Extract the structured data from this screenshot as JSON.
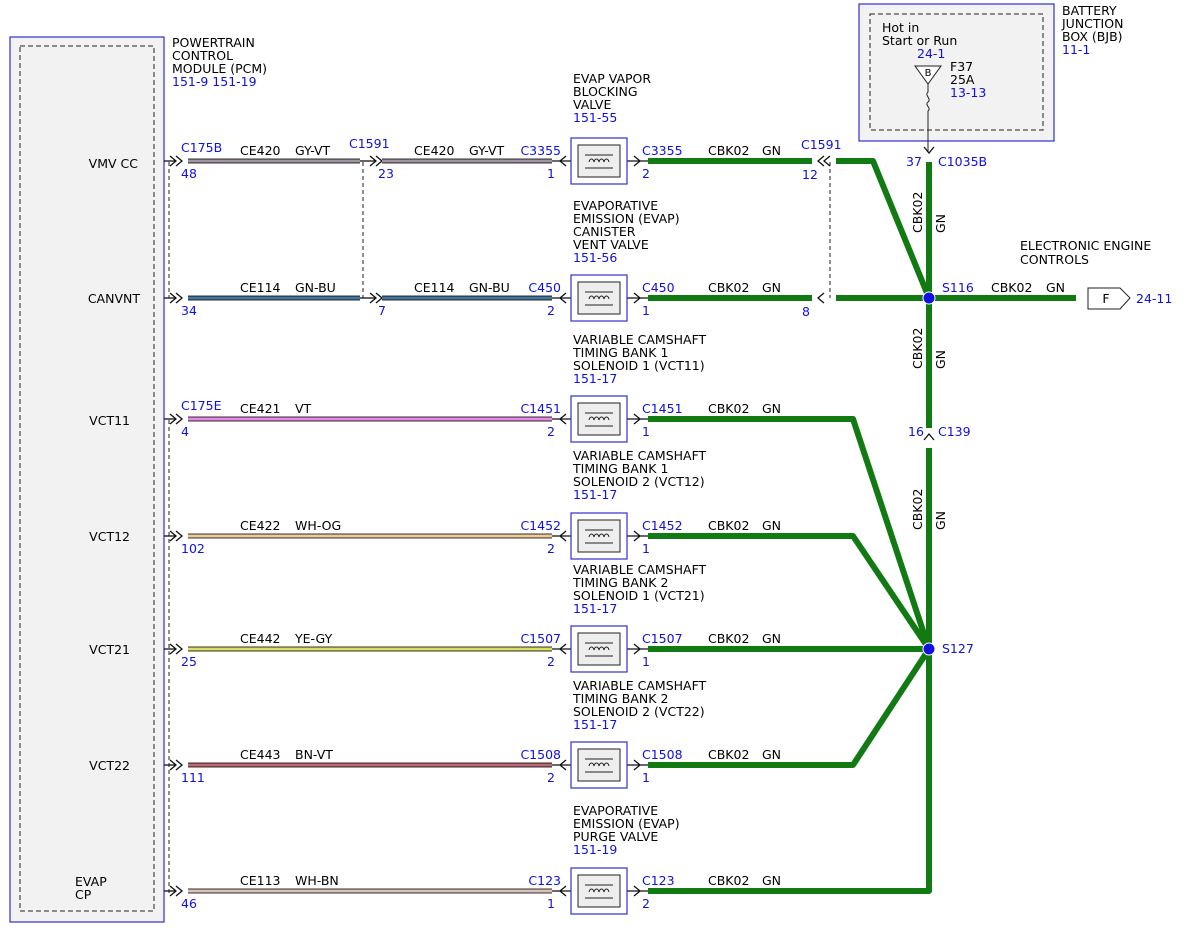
{
  "colors": {
    "gn": "#127a12",
    "gy_vt": "#8f7f8f",
    "gn_bu": "#1e5a8a",
    "vt": "#e470de",
    "wh_og": "#e9c080",
    "ye_gy": "#d6d640",
    "bn_vt": "#b04858",
    "wh_bn": "#d8b4ac",
    "ref_blue": "#1010e0",
    "box_blue": "#3030d0"
  },
  "pcm": {
    "title_lines": [
      "POWERTRAIN",
      "CONTROL",
      "MODULE (PCM)"
    ],
    "refs": "151-9  151-19"
  },
  "pins": {
    "vmv_cc": "VMV CC",
    "canvnt": "CANVNT",
    "vct11": "VCT11",
    "vct12": "VCT12",
    "vct21": "VCT21",
    "vct22": "VCT22",
    "evap_cp_1": "EVAP",
    "evap_cp_2": "CP"
  },
  "bjb": {
    "title_lines": [
      "BATTERY",
      "JUNCTION",
      "BOX (BJB)"
    ],
    "ref": "11-1",
    "hot_1": "Hot in",
    "hot_2": "Start or Run",
    "hot_ref": "24-1",
    "bus": "B",
    "fuse": "F37",
    "amps": "25A",
    "fuse_ref": "13-13"
  },
  "circuits": [
    {
      "id": "r1",
      "pcm_conn": "C175B",
      "pcm_pin": "48",
      "circuit": "CE420",
      "color_code": "GY-VT",
      "inline_conn": "C1591",
      "inline_pin": "23",
      "circuit2": "CE420",
      "color_code2": "GY-VT",
      "comp_conn_in": "C3355",
      "comp_pin_in": "1",
      "comp_conn_out": "C3355",
      "comp_pin_out": "2",
      "gnd_circuit": "CBK02",
      "gnd_color": "GN",
      "end_conn": "C1591",
      "end_pin": "12",
      "comp_lines": [
        "EVAP VAPOR",
        "BLOCKING",
        "VALVE"
      ],
      "comp_ref": "151-55"
    },
    {
      "id": "r2",
      "pcm_pin": "34",
      "circuit": "CE114",
      "color_code": "GN-BU",
      "inline_pin": "7",
      "circuit2": "CE114",
      "color_code2": "GN-BU",
      "comp_conn_in": "C450",
      "comp_pin_in": "2",
      "comp_conn_out": "C450",
      "comp_pin_out": "1",
      "gnd_circuit": "CBK02",
      "gnd_color": "GN",
      "end_pin": "8",
      "comp_lines": [
        "EVAPORATIVE",
        "EMISSION (EVAP)",
        "CANISTER",
        "VENT VALVE"
      ],
      "comp_ref": "151-56"
    },
    {
      "id": "r3",
      "pcm_conn": "C175E",
      "pcm_pin": "4",
      "circuit": "CE421",
      "color_code": "VT",
      "comp_conn_in": "C1451",
      "comp_pin_in": "2",
      "comp_conn_out": "C1451",
      "comp_pin_out": "1",
      "gnd_circuit": "CBK02",
      "gnd_color": "GN",
      "comp_lines": [
        "VARIABLE CAMSHAFT",
        "TIMING BANK 1",
        "SOLENOID 1 (VCT11)"
      ],
      "comp_ref": "151-17"
    },
    {
      "id": "r4",
      "pcm_pin": "102",
      "circuit": "CE422",
      "color_code": "WH-OG",
      "comp_conn_in": "C1452",
      "comp_pin_in": "2",
      "comp_conn_out": "C1452",
      "comp_pin_out": "1",
      "gnd_circuit": "CBK02",
      "gnd_color": "GN",
      "comp_lines": [
        "VARIABLE CAMSHAFT",
        "TIMING BANK 1",
        "SOLENOID 2 (VCT12)"
      ],
      "comp_ref": "151-17"
    },
    {
      "id": "r5",
      "pcm_pin": "25",
      "circuit": "CE442",
      "color_code": "YE-GY",
      "comp_conn_in": "C1507",
      "comp_pin_in": "2",
      "comp_conn_out": "C1507",
      "comp_pin_out": "1",
      "gnd_circuit": "CBK02",
      "gnd_color": "GN",
      "comp_lines": [
        "VARIABLE CAMSHAFT",
        "TIMING BANK 2",
        "SOLENOID 1 (VCT21)"
      ],
      "comp_ref": "151-17"
    },
    {
      "id": "r6",
      "pcm_pin": "111",
      "circuit": "CE443",
      "color_code": "BN-VT",
      "comp_conn_in": "C1508",
      "comp_pin_in": "2",
      "comp_conn_out": "C1508",
      "comp_pin_out": "1",
      "gnd_circuit": "CBK02",
      "gnd_color": "GN",
      "comp_lines": [
        "VARIABLE CAMSHAFT",
        "TIMING BANK 2",
        "SOLENOID 2 (VCT22)"
      ],
      "comp_ref": "151-17"
    },
    {
      "id": "r7",
      "pcm_pin": "46",
      "circuit": "CE113",
      "color_code": "WH-BN",
      "comp_conn_in": "C123",
      "comp_pin_in": "1",
      "comp_conn_out": "C123",
      "comp_pin_out": "2",
      "gnd_circuit": "CBK02",
      "gnd_color": "GN",
      "comp_lines": [
        "EVAPORATIVE",
        "EMISSION (EVAP)",
        "PURGE VALVE"
      ],
      "comp_ref": "151-19"
    }
  ],
  "trunk": {
    "c1035b_pin": "37",
    "c1035b": "C1035B",
    "seg1_circuit": "CBK02",
    "seg1_color": "GN",
    "s116": "S116",
    "out_circuit": "CBK02",
    "out_color": "GN",
    "seg2_circuit": "CBK02",
    "seg2_color": "GN",
    "c139_pin": "16",
    "c139": "C139",
    "seg3_circuit": "CBK02",
    "seg3_color": "GN",
    "s127": "S127"
  },
  "eec": {
    "title_1": "ELECTRONIC ENGINE",
    "title_2": "CONTROLS",
    "arrow_label": "F",
    "ref": "24-11"
  }
}
